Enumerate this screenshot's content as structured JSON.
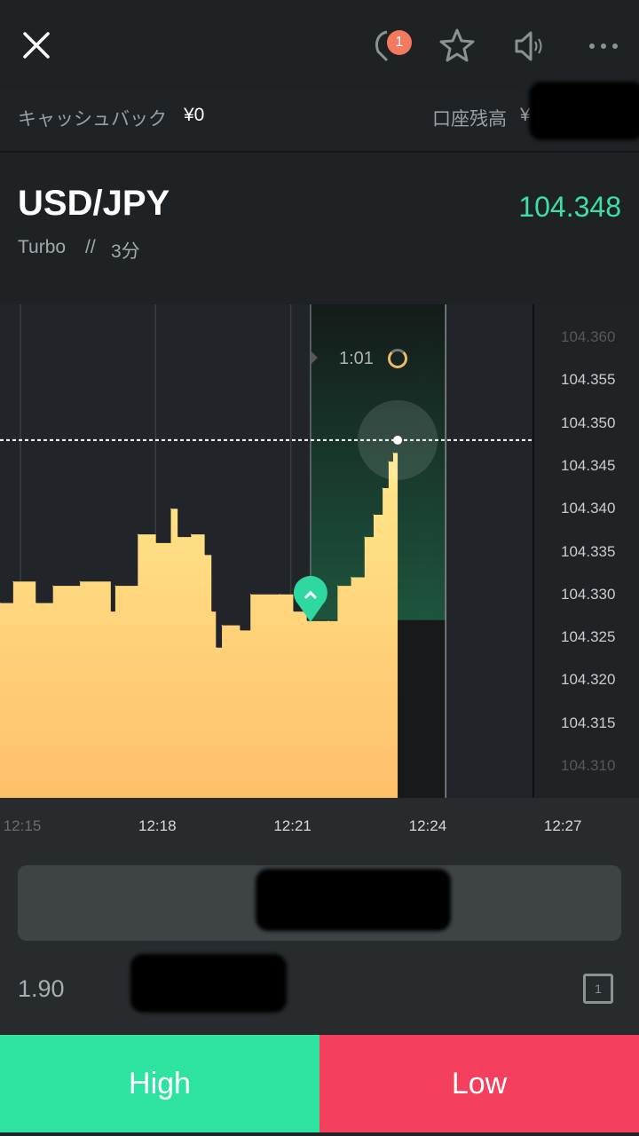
{
  "topbar": {
    "close_icon": "close-icon",
    "notification_count": "1",
    "icons": [
      "chat-bubble-icon",
      "star-icon",
      "speaker-icon",
      "more-icon"
    ]
  },
  "info": {
    "cashback_label": "キャッシュバック",
    "cashback_value": "¥0",
    "balance_label": "口座残高",
    "balance_currency": "¥"
  },
  "header": {
    "pair": "USD/JPY",
    "mode": "Turbo",
    "separator": "//",
    "duration": "3分",
    "current_price": "104.348"
  },
  "chart": {
    "countdown": "1:01",
    "entry_direction": "high"
  },
  "chart_data": {
    "type": "area",
    "x_unit": "time",
    "yticks": [
      "104.360",
      "104.355",
      "104.350",
      "104.345",
      "104.340",
      "104.335",
      "104.330",
      "104.325",
      "104.320",
      "104.315",
      "104.310"
    ],
    "xticks": [
      "12:15",
      "12:18",
      "12:21",
      "12:24",
      "12:27"
    ],
    "ylim": [
      104.308,
      104.364
    ],
    "current_price": 104.348,
    "entry": {
      "time": "12:21:24",
      "price": 104.327
    },
    "trade_window": {
      "start": "12:21:24",
      "end": "12:24:24"
    },
    "series": [
      {
        "points": [
          [
            "12:14:30",
            104.329
          ],
          [
            "12:14:48",
            104.3315
          ],
          [
            "12:15:18",
            104.329
          ],
          [
            "12:15:41",
            104.331
          ],
          [
            "12:16:17",
            104.3315
          ],
          [
            "12:16:58",
            104.328
          ],
          [
            "12:17:04",
            104.331
          ],
          [
            "12:17:34",
            104.337
          ],
          [
            "12:17:58",
            104.336
          ],
          [
            "12:18:18",
            104.34
          ],
          [
            "12:18:27",
            104.3367
          ],
          [
            "12:18:45",
            104.337
          ],
          [
            "12:19:03",
            104.3346
          ],
          [
            "12:19:12",
            104.328
          ],
          [
            "12:19:18",
            104.3238
          ],
          [
            "12:19:26",
            104.3264
          ],
          [
            "12:19:50",
            104.3258
          ],
          [
            "12:20:04",
            104.33
          ],
          [
            "12:20:43",
            104.33
          ],
          [
            "12:21:01",
            104.328
          ],
          [
            "12:21:19",
            104.3269
          ],
          [
            "12:21:48",
            104.3269
          ],
          [
            "12:22:00",
            104.331
          ],
          [
            "12:22:18",
            104.332
          ],
          [
            "12:22:36",
            104.3367
          ],
          [
            "12:22:48",
            104.3393
          ],
          [
            "12:23:00",
            104.3424
          ],
          [
            "12:23:08",
            104.3455
          ],
          [
            "12:23:14",
            104.3465
          ],
          [
            "12:23:20",
            104.348
          ]
        ]
      }
    ],
    "colors": {
      "area_top": "#ffe585",
      "area_bottom": "#ffbe6a",
      "zone": "#1d5a40",
      "marker": "#2ed8a0"
    }
  },
  "trade": {
    "payout": "1.90",
    "quick_icon": "one-click-icon"
  },
  "actions": {
    "high_label": "High",
    "low_label": "Low",
    "high_color": "#2ee3a0",
    "low_color": "#f43f5e"
  }
}
